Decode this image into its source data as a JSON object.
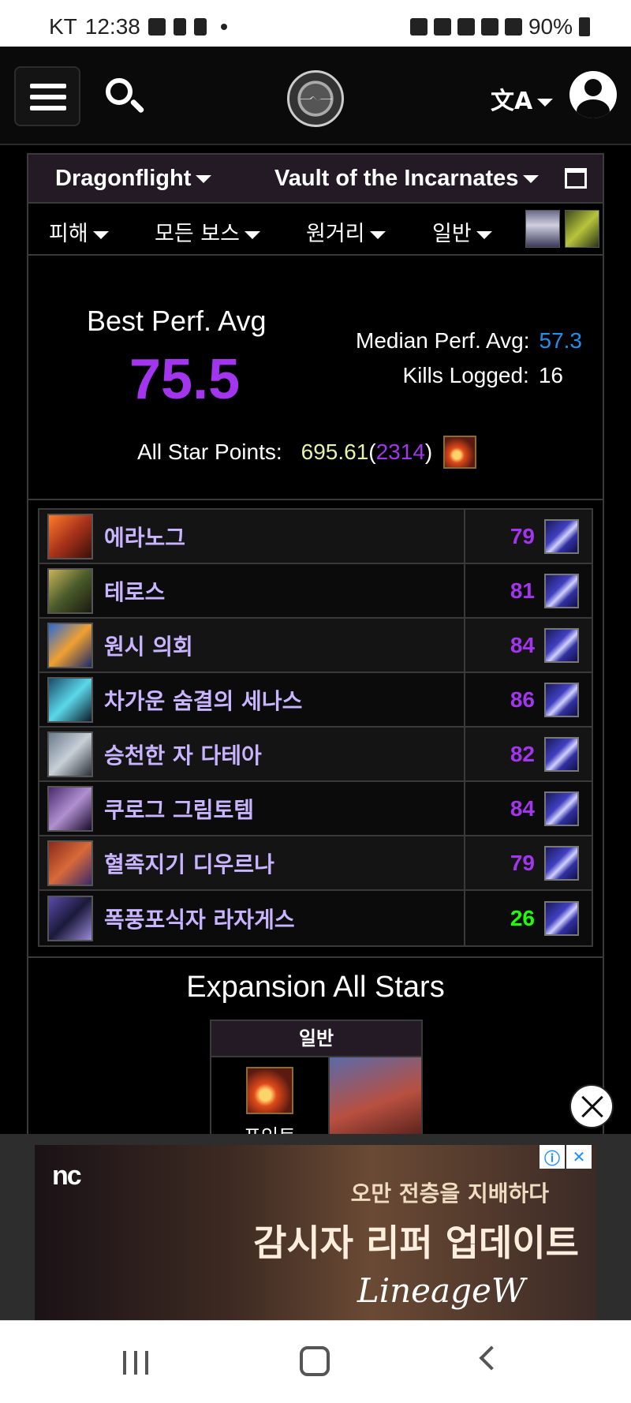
{
  "status_bar": {
    "carrier": "KT",
    "time": "12:38",
    "battery": "90%"
  },
  "header": {
    "icons": [
      "menu-icon",
      "search-icon",
      "logo",
      "translate-icon",
      "account-icon"
    ]
  },
  "filters": {
    "expansion": "Dragonflight",
    "raid": "Vault of the Incarnates",
    "metric": "피해",
    "boss": "모든 보스",
    "role": "원거리",
    "difficulty": "일반"
  },
  "summary": {
    "best_label": "Best Perf. Avg",
    "best_value": "75.5",
    "median_label": "Median Perf. Avg:",
    "median_value": "57.3",
    "kills_label": "Kills Logged:",
    "kills_value": "16",
    "allstar_label": "All Star Points:",
    "allstar_points": "695.61",
    "allstar_open": " (",
    "allstar_rank": "2314",
    "allstar_close": ")"
  },
  "bosses": [
    {
      "name": "에라노그",
      "score": "79",
      "color": "#a335ee"
    },
    {
      "name": "테로스",
      "score": "81",
      "color": "#a335ee"
    },
    {
      "name": "원시 의회",
      "score": "84",
      "color": "#a335ee"
    },
    {
      "name": "차가운 숨결의 세나스",
      "score": "86",
      "color": "#a335ee"
    },
    {
      "name": "승천한 자 다테아",
      "score": "82",
      "color": "#a335ee"
    },
    {
      "name": "쿠로그 그림토템",
      "score": "84",
      "color": "#a335ee"
    },
    {
      "name": "혈족지기 디우르나",
      "score": "79",
      "color": "#a335ee"
    },
    {
      "name": "폭풍포식자 라자게스",
      "score": "26",
      "color": "#1eff00"
    }
  ],
  "expansion_all_stars": {
    "title": "Expansion All Stars",
    "column_header": "일반",
    "points_label": "포인트"
  },
  "ad": {
    "brand": "nc",
    "tagline": "오만 전층을 지배하다",
    "headline": "감시자 리퍼 업데이트",
    "game": "LineageW"
  }
}
